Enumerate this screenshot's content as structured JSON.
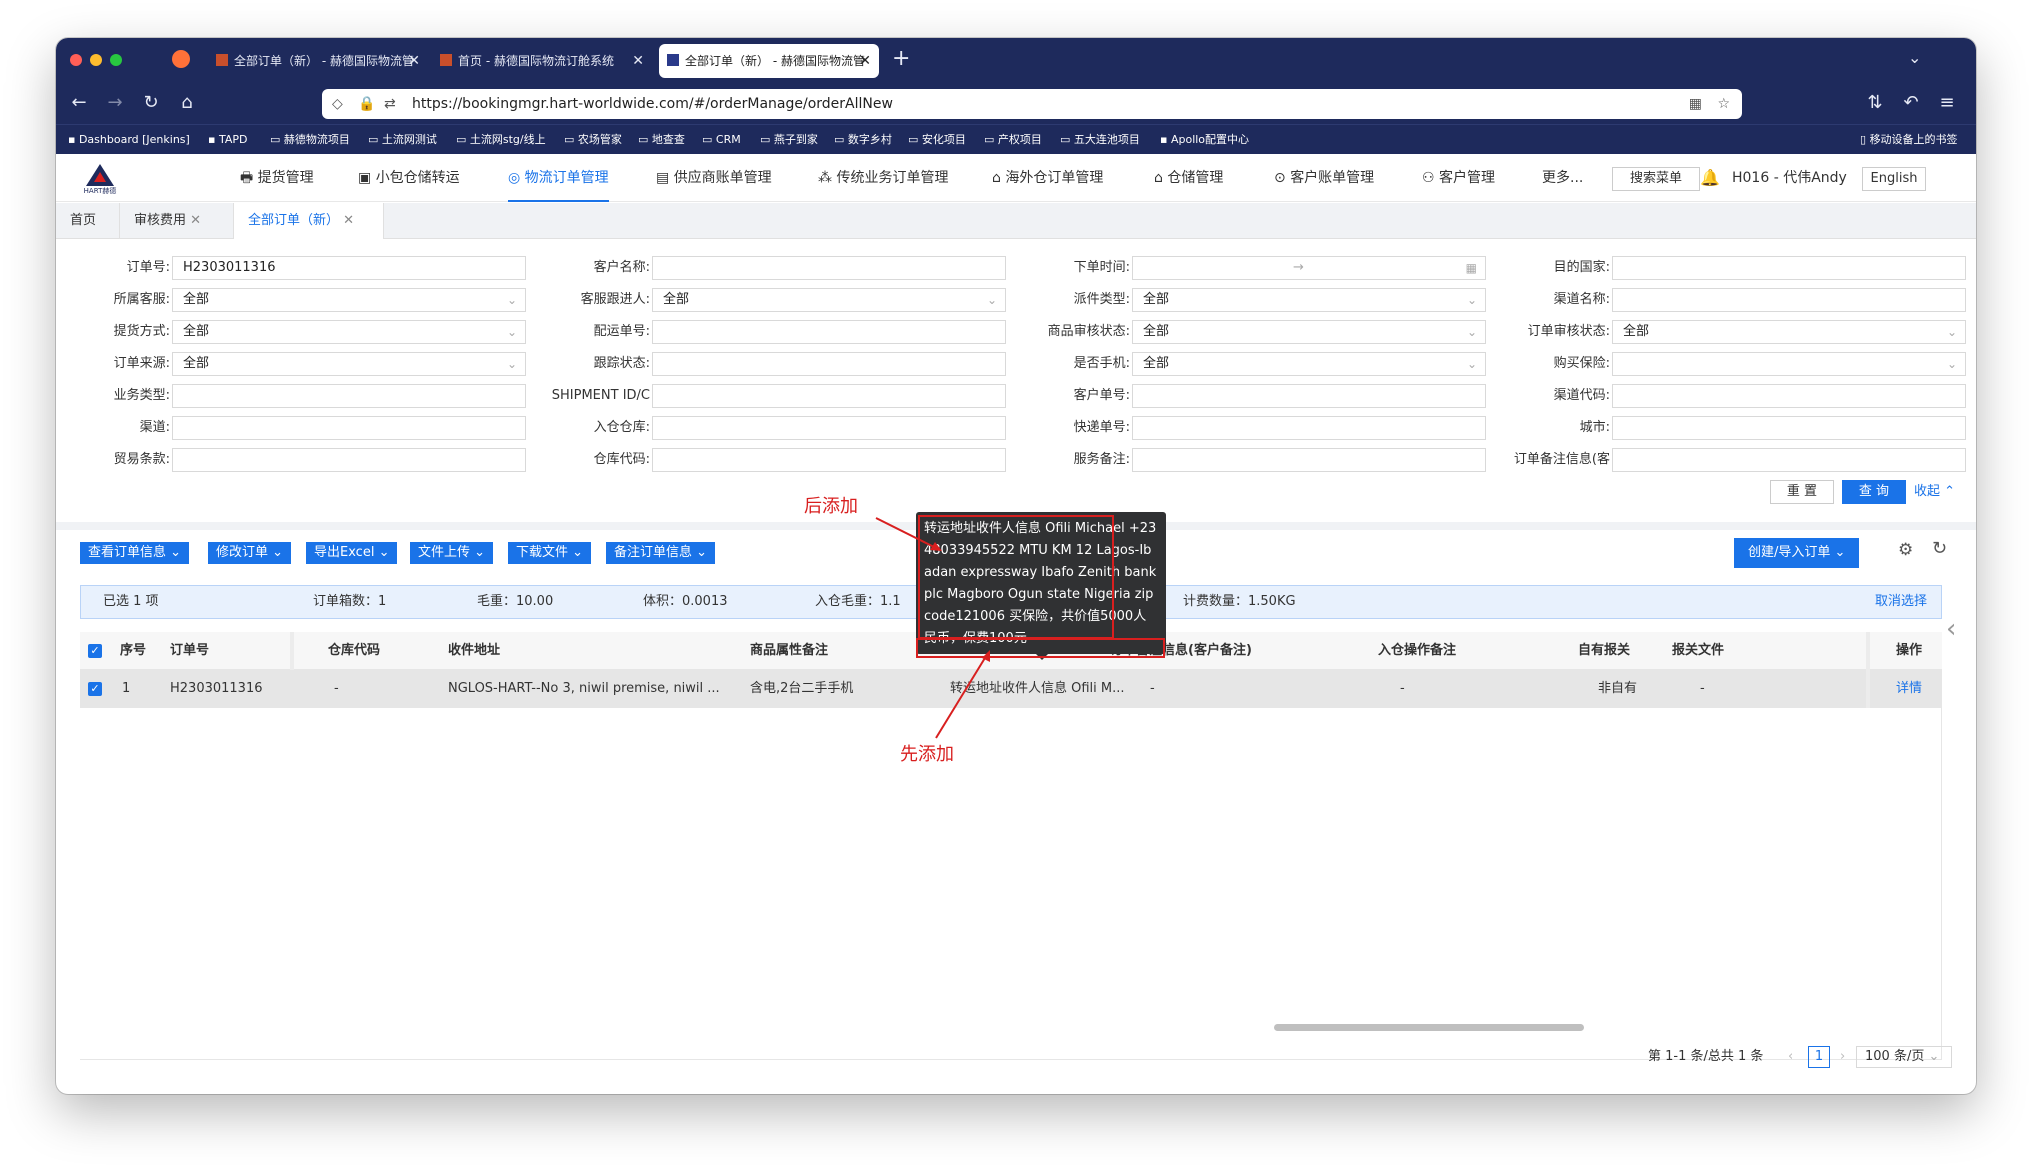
{
  "browser": {
    "tabs": [
      {
        "label": "全部订单（新） - 赫德国际物流管"
      },
      {
        "label": "首页 - 赫德国际物流订舱系统"
      },
      {
        "label": "全部订单（新） - 赫德国际物流管"
      }
    ],
    "url": "https://bookingmgr.hart-worldwide.com/#/orderManage/orderAllNew",
    "bookmarks": [
      "Dashboard [Jenkins]",
      "TAPD",
      "赫德物流项目",
      "土流网测试",
      "土流网stg/线上",
      "农场管家",
      "地查查",
      "CRM",
      "燕子到家",
      "数字乡村",
      "安化项目",
      "产权项目",
      "五大连池项目",
      "Apollo配置中心"
    ],
    "bookmarks_right": "移动设备上的书签"
  },
  "app": {
    "logo_text": "HART赫德",
    "menus": [
      "提货管理",
      "小包仓储转运",
      "物流订单管理",
      "供应商账单管理",
      "传统业务订单管理",
      "海外仓订单管理",
      "仓储管理",
      "客户账单管理",
      "客户管理",
      "更多..."
    ],
    "search_menu": "搜索菜单",
    "user": "H016 - 代伟Andy",
    "language": "English"
  },
  "page_tabs": [
    "首页",
    "审核费用",
    "全部订单（新）"
  ],
  "filters": [
    {
      "label": "订单号:",
      "value": "H2303011316",
      "type": "text"
    },
    {
      "label": "客户名称:",
      "value": "",
      "type": "text"
    },
    {
      "label": "下单时间:",
      "value": "",
      "type": "date"
    },
    {
      "label": "目的国家:",
      "value": "",
      "type": "text"
    },
    {
      "label": "所属客服:",
      "value": "全部",
      "type": "select"
    },
    {
      "label": "客服跟进人:",
      "value": "全部",
      "type": "select"
    },
    {
      "label": "派件类型:",
      "value": "全部",
      "type": "select"
    },
    {
      "label": "渠道名称:",
      "value": "",
      "type": "text"
    },
    {
      "label": "提货方式:",
      "value": "全部",
      "type": "select"
    },
    {
      "label": "配运单号:",
      "value": "",
      "type": "text"
    },
    {
      "label": "商品审核状态:",
      "value": "全部",
      "type": "select"
    },
    {
      "label": "订单审核状态:",
      "value": "全部",
      "type": "select"
    },
    {
      "label": "订单来源:",
      "value": "全部",
      "type": "select"
    },
    {
      "label": "跟踪状态:",
      "value": "",
      "type": "text"
    },
    {
      "label": "是否手机:",
      "value": "全部",
      "type": "select"
    },
    {
      "label": "购买保险:",
      "value": "",
      "type": "select"
    },
    {
      "label": "业务类型:",
      "value": "",
      "type": "text"
    },
    {
      "label": "SHIPMENT ID/C",
      "value": "",
      "type": "text"
    },
    {
      "label": "客户单号:",
      "value": "",
      "type": "text"
    },
    {
      "label": "渠道代码:",
      "value": "",
      "type": "text"
    },
    {
      "label": "渠道:",
      "value": "",
      "type": "text"
    },
    {
      "label": "入仓仓库:",
      "value": "",
      "type": "text"
    },
    {
      "label": "快递单号:",
      "value": "",
      "type": "text"
    },
    {
      "label": "城市:",
      "value": "",
      "type": "text"
    },
    {
      "label": "贸易条款:",
      "value": "",
      "type": "text"
    },
    {
      "label": "仓库代码:",
      "value": "",
      "type": "text"
    },
    {
      "label": "服务备注:",
      "value": "",
      "type": "text"
    },
    {
      "label": "订单备注信息(客",
      "value": "",
      "type": "text"
    }
  ],
  "actions": {
    "reset": "重 置",
    "query": "查 询",
    "collapse": "收起"
  },
  "toolbar": [
    "查看订单信息",
    "修改订单",
    "导出Excel",
    "文件上传",
    "下载文件",
    "备注订单信息"
  ],
  "create_button": "创建/导入订单",
  "selection": {
    "selected": "已选 1 项",
    "boxes": "订单箱数：1",
    "gross_weight": "毛重：10.00",
    "volume": "体积：0.0013",
    "in_weight": "入仓毛重：1.1",
    "billing_qty": "计费数量：1.50KG",
    "cancel": "取消选择"
  },
  "table": {
    "headers": [
      "序号",
      "订单号",
      "仓库代码",
      "收件地址",
      "商品属性备注",
      "订单备注信息(客户备注)",
      "入仓操作备注",
      "自有报关",
      "报关文件",
      "操作"
    ],
    "row": {
      "index": "1",
      "order_no": "H2303011316",
      "warehouse": "-",
      "address": "NGLOS-HART--No 3, niwil premise, niwil ...",
      "goods_note": "含电,2台二手手机",
      "service_note": "转运地址收件人信息 Ofili M...",
      "customer_note": "-",
      "in_note": "-",
      "own_customs": "非自有",
      "customs_file": "-",
      "op": "详情"
    }
  },
  "tooltip": "转运地址收件人信息 Ofili Michael +2348033945522 MTU KM 12 Lagos-Ibadan expressway Ibafo Zenith bank plc Magboro Ogun state Nigeria zip code121006 买保险，共价值5000人民币，保费100元",
  "annotations": {
    "after": "后添加",
    "before": "先添加"
  },
  "pager": {
    "summary": "第 1-1 条/总共 1 条",
    "page": "1",
    "size": "100 条/页"
  }
}
